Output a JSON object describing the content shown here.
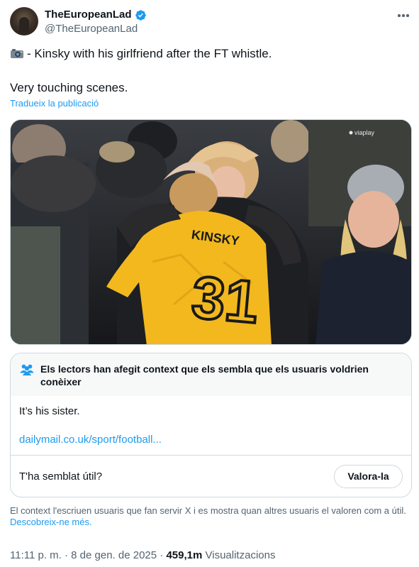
{
  "author": {
    "display_name": "TheEuropeanLad",
    "handle": "@TheEuropeanLad",
    "verified": true
  },
  "tweet": {
    "line1": "- Kinsky with his girlfriend after the FT whistle.",
    "line2": "Very touching scenes.",
    "translate_label": "Tradueix la publicació",
    "emoji_icon": "camera-flash-icon"
  },
  "media": {
    "watermark": "viaplay",
    "shirt_name": "KINSKY",
    "shirt_number": "31"
  },
  "community_note": {
    "title": "Els lectors han afegit context que els sembla que els usuaris voldrien conèixer",
    "body": "It’s his sister.",
    "link": "dailymail.co.uk/sport/football...",
    "helpful_question": "T'ha semblat útil?",
    "rate_button": "Valora-la"
  },
  "disclaimer": {
    "text": "El context l'escriuen usuaris que fan servir X i es mostra quan altres usuaris el valoren com a útil.",
    "link": "Descobreix-ne més."
  },
  "meta": {
    "time": "11:11 p. m.",
    "separator": "·",
    "date": "8 de gen. de 2025",
    "views_count": "459,1m",
    "views_label": "Visualitzacions"
  },
  "colors": {
    "accent": "#1d9bf0",
    "text": "#0f1419",
    "muted": "#536471",
    "border": "#cfd9de",
    "shirt_yellow": "#f2b81e"
  }
}
